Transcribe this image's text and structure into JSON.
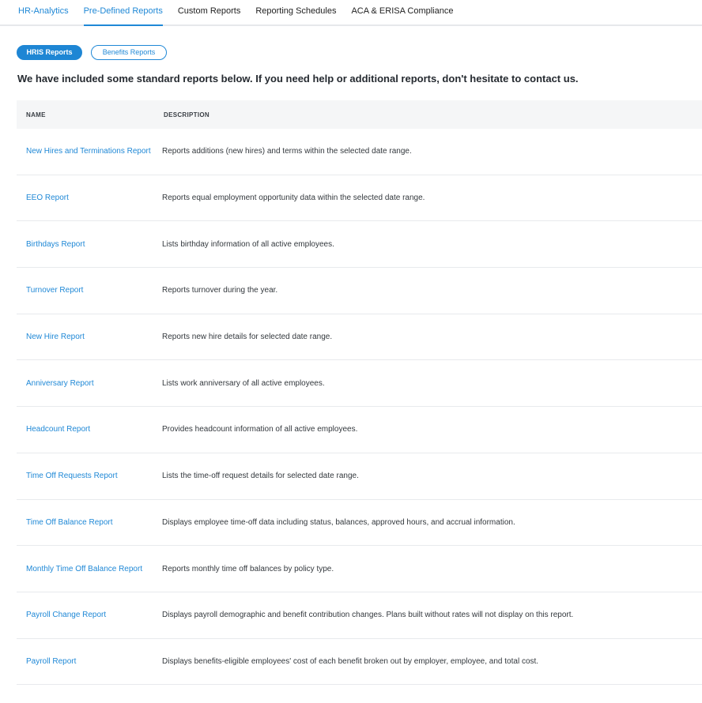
{
  "nav": {
    "tabs": [
      {
        "label": "HR-Analytics"
      },
      {
        "label": "Pre-Defined Reports"
      },
      {
        "label": "Custom Reports"
      },
      {
        "label": "Reporting Schedules"
      },
      {
        "label": "ACA & ERISA Compliance"
      }
    ],
    "active_tab": "Pre-Defined Reports"
  },
  "toggle": {
    "hris_label": "HRIS Reports",
    "benefits_label": "Benefits Reports",
    "selected": "HRIS Reports"
  },
  "intro_text": "We have included some standard reports below. If you need help or additional reports, don't hesitate to contact us.",
  "table": {
    "headers": {
      "name": "NAME",
      "description": "DESCRIPTION"
    },
    "rows": [
      {
        "name": "New Hires and Terminations Report",
        "description": "Reports additions (new hires) and terms within the selected date range."
      },
      {
        "name": "EEO Report",
        "description": "Reports equal employment opportunity data within the selected date range."
      },
      {
        "name": "Birthdays Report",
        "description": "Lists birthday information of all active employees."
      },
      {
        "name": "Turnover Report",
        "description": "Reports turnover during the year."
      },
      {
        "name": "New Hire Report",
        "description": "Reports new hire details for selected date range."
      },
      {
        "name": "Anniversary Report",
        "description": "Lists work anniversary of all active employees."
      },
      {
        "name": "Headcount Report",
        "description": "Provides headcount information of all active employees."
      },
      {
        "name": "Time Off Requests Report",
        "description": "Lists the time-off request details for selected date range."
      },
      {
        "name": "Time Off Balance Report",
        "description": "Displays employee time-off data including status, balances, approved hours, and accrual information."
      },
      {
        "name": "Monthly Time Off Balance Report",
        "description": "Reports monthly time off balances by policy type."
      },
      {
        "name": "Payroll Change Report",
        "description": "Displays payroll demographic and benefit contribution changes. Plans built without rates will not display on this report."
      },
      {
        "name": "Payroll Report",
        "description": "Displays benefits-eligible employees' cost of each benefit broken out by employer, employee, and total cost."
      }
    ]
  },
  "colors": {
    "accent": "#1f88d6",
    "header_bg": "#f5f6f7",
    "divider": "#e8eaed"
  }
}
